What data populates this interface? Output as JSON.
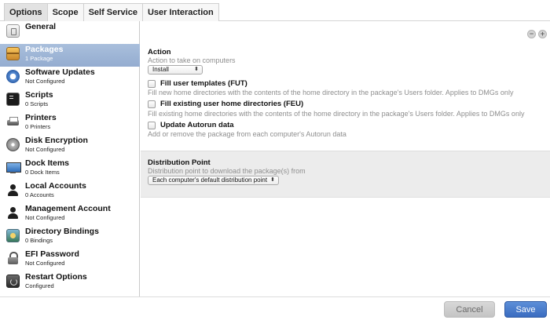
{
  "tabs": [
    "Options",
    "Scope",
    "Self Service",
    "User Interaction"
  ],
  "sidebar": {
    "items": [
      {
        "title": "General",
        "subtitle": "",
        "icon": "general-icon"
      },
      {
        "title": "Packages",
        "subtitle": "1 Package",
        "icon": "package-icon"
      },
      {
        "title": "Software Updates",
        "subtitle": "Not Configured",
        "icon": "software-update-icon"
      },
      {
        "title": "Scripts",
        "subtitle": "0 Scripts",
        "icon": "script-terminal-icon"
      },
      {
        "title": "Printers",
        "subtitle": "0 Printers",
        "icon": "printer-icon"
      },
      {
        "title": "Disk Encryption",
        "subtitle": "Not Configured",
        "icon": "disk-icon"
      },
      {
        "title": "Dock Items",
        "subtitle": "0 Dock Items",
        "icon": "dock-icon"
      },
      {
        "title": "Local Accounts",
        "subtitle": "0 Accounts",
        "icon": "user-icon"
      },
      {
        "title": "Management Account",
        "subtitle": "Not Configured",
        "icon": "user-icon"
      },
      {
        "title": "Directory Bindings",
        "subtitle": "0 Bindings",
        "icon": "directory-icon"
      },
      {
        "title": "EFI Password",
        "subtitle": "Not Configured",
        "icon": "lock-icon"
      },
      {
        "title": "Restart Options",
        "subtitle": "Configured",
        "icon": "restart-icon"
      }
    ],
    "selected": "Packages"
  },
  "main": {
    "minus_icon": "−",
    "plus_icon": "+",
    "action": {
      "label": "Action",
      "help": "Action to take on computers",
      "value": "Install"
    },
    "fut": {
      "label": "Fill user templates (FUT)",
      "help": "Fill new home directories with the contents of the home directory in the package's Users folder. Applies to DMGs only",
      "checked": false
    },
    "feu": {
      "label": "Fill existing user home directories (FEU)",
      "help": "Fill existing home directories with the contents of the home directory in the package's Users folder. Applies to DMGs only",
      "checked": false
    },
    "autorun": {
      "label": "Update Autorun data",
      "help": "Add or remove the package from each computer's Autorun data",
      "checked": false
    },
    "distribution": {
      "label": "Distribution Point",
      "help": "Distribution point to download the package(s) from",
      "value": "Each computer's default distribution point"
    }
  },
  "footer": {
    "cancel_label": "Cancel",
    "save_label": "Save"
  },
  "colors": {
    "selected_item": "#9cb3d6",
    "save_button": "#4a7bcc",
    "section_background": "#ececec"
  }
}
